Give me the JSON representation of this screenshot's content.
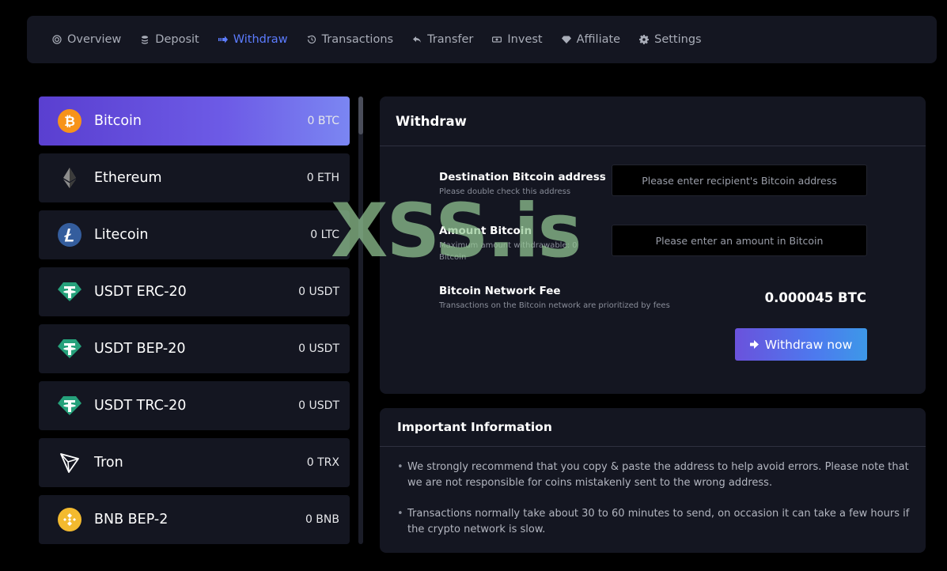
{
  "nav": {
    "items": [
      {
        "label": "Overview",
        "icon": "target-icon",
        "active": false
      },
      {
        "label": "Deposit",
        "icon": "coins-icon",
        "active": false
      },
      {
        "label": "Withdraw",
        "icon": "arrow-out-icon",
        "active": true
      },
      {
        "label": "Transactions",
        "icon": "history-icon",
        "active": false
      },
      {
        "label": "Transfer",
        "icon": "reply-icon",
        "active": false
      },
      {
        "label": "Invest",
        "icon": "banknote-icon",
        "active": false
      },
      {
        "label": "Affiliate",
        "icon": "gem-icon",
        "active": false
      },
      {
        "label": "Settings",
        "icon": "gear-icon",
        "active": false
      }
    ],
    "active_color": "#5c7cff"
  },
  "coins": [
    {
      "name": "Bitcoin",
      "balance": "0 BTC",
      "icon": "bitcoin-icon",
      "color": "#f7931a",
      "active": true
    },
    {
      "name": "Ethereum",
      "balance": "0 ETH",
      "icon": "ethereum-icon",
      "color": "#8c8c8c",
      "active": false
    },
    {
      "name": "Litecoin",
      "balance": "0 LTC",
      "icon": "litecoin-icon",
      "color": "#345d9d",
      "active": false
    },
    {
      "name": "USDT ERC-20",
      "balance": "0 USDT",
      "icon": "tether-icon",
      "color": "#26a17b",
      "active": false
    },
    {
      "name": "USDT BEP-20",
      "balance": "0 USDT",
      "icon": "tether-icon",
      "color": "#26a17b",
      "active": false
    },
    {
      "name": "USDT TRC-20",
      "balance": "0 USDT",
      "icon": "tether-icon",
      "color": "#26a17b",
      "active": false
    },
    {
      "name": "Tron",
      "balance": "0 TRX",
      "icon": "tron-icon",
      "color": "#ffffff",
      "active": false
    },
    {
      "name": "BNB BEP-2",
      "balance": "0 BNB",
      "icon": "bnb-icon",
      "color": "#f3ba2f",
      "active": false
    }
  ],
  "withdraw": {
    "title": "Withdraw",
    "address_label": "Destination Bitcoin address",
    "address_hint": "Please double check this address",
    "address_placeholder": "Please enter recipient's Bitcoin address",
    "amount_label": "Amount Bitcoin",
    "amount_hint": "Maximum amount withdrawable: 0 Bitcoin",
    "amount_placeholder": "Please enter an amount in Bitcoin",
    "fee_label": "Bitcoin Network Fee",
    "fee_hint": "Transactions on the Bitcoin network are prioritized by fees",
    "fee_value": "0.000045 BTC",
    "button_label": "Withdraw now"
  },
  "info": {
    "title": "Important Information",
    "items": [
      "We strongly recommend that you copy & paste the address to help avoid errors. Please note that we are not responsible for coins mistakenly sent to the wrong address.",
      "Transactions normally take about 30 to 60 minutes to send, on occasion it can take a few hours if the crypto network is slow."
    ]
  },
  "watermark": "XSS.is"
}
